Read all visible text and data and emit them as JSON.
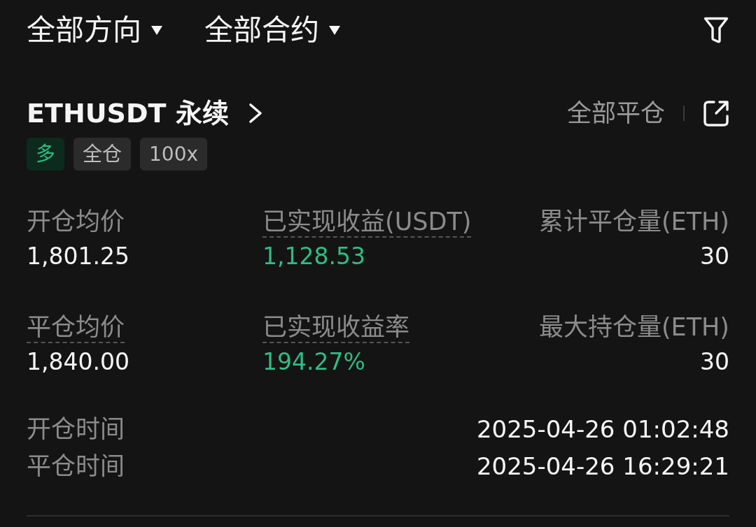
{
  "filters": [
    {
      "label": "全部方向"
    },
    {
      "label": "全部合约"
    }
  ],
  "position": {
    "symbol": "ETHUSDT 永续",
    "close_all": "全部平仓",
    "tags": [
      {
        "label": "多",
        "kind": "long"
      },
      {
        "label": "全仓",
        "kind": "plain"
      },
      {
        "label": "100x",
        "kind": "plain"
      }
    ],
    "stats": [
      {
        "label": "开仓均价",
        "value": "1,801.25",
        "underlined": false,
        "positive": false
      },
      {
        "label": "已实现收益(USDT)",
        "value": "1,128.53",
        "underlined": true,
        "positive": true
      },
      {
        "label": "累计平仓量(ETH)",
        "value": "30",
        "underlined": false,
        "positive": false
      },
      {
        "label": "平仓均价",
        "value": "1,840.00",
        "underlined": true,
        "positive": false
      },
      {
        "label": "已实现收益率",
        "value": "194.27%",
        "underlined": true,
        "positive": true
      },
      {
        "label": "最大持仓量(ETH)",
        "value": "30",
        "underlined": false,
        "positive": false
      }
    ],
    "times": [
      {
        "label": "开仓时间",
        "value": "2025-04-26 01:02:48"
      },
      {
        "label": "平仓时间",
        "value": "2025-04-26 16:29:21"
      }
    ]
  }
}
